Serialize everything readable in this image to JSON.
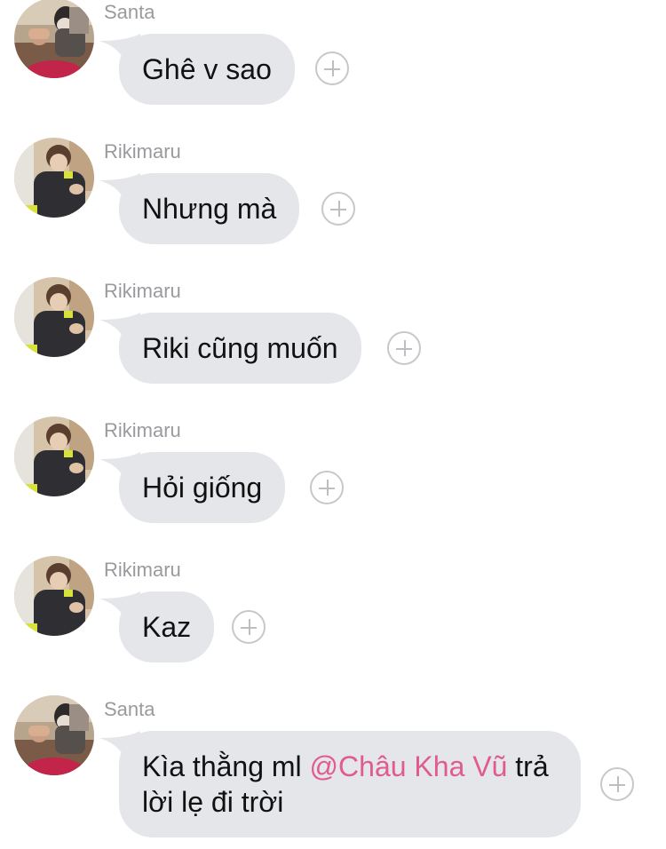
{
  "messages": [
    {
      "sender": "Santa",
      "text": "Ghê v sao",
      "avatar": "santa-avatar"
    },
    {
      "sender": "Rikimaru",
      "text": "Nhưng mà",
      "avatar": "rikimaru-avatar"
    },
    {
      "sender": "Rikimaru",
      "text": "Riki cũng muốn",
      "avatar": "rikimaru-avatar"
    },
    {
      "sender": "Rikimaru",
      "text": "Hỏi giống",
      "avatar": "rikimaru-avatar"
    },
    {
      "sender": "Rikimaru",
      "text": "Kaz",
      "avatar": "rikimaru-avatar"
    },
    {
      "sender": "Santa",
      "text_before": "Kìa thằng ml ",
      "mention": "@Châu Kha Vũ",
      "text_after": " trả",
      "text_line2": "lời lẹ đi trời",
      "avatar": "santa-avatar"
    }
  ],
  "icons": {
    "react": "add-reaction-icon"
  },
  "colors": {
    "bubble": "#e4e6ea",
    "mention": "#e05c8e",
    "sender": "#9a9a9e"
  }
}
